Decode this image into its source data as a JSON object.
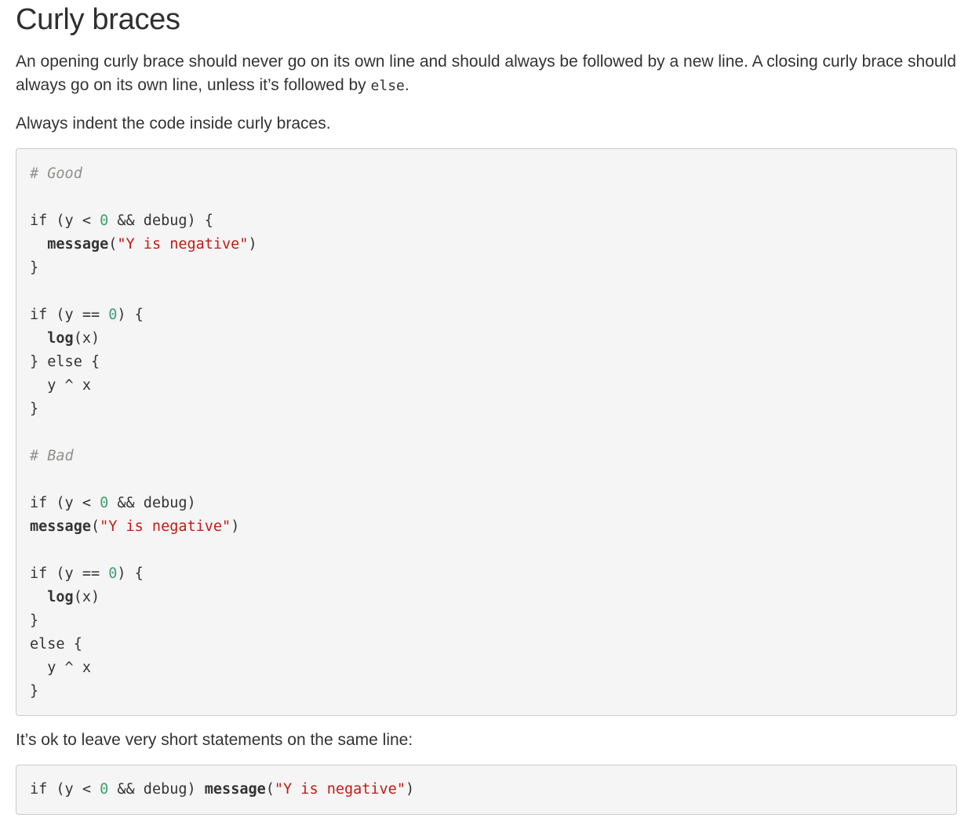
{
  "section": {
    "title": "Curly braces",
    "intro": {
      "before": "An opening curly brace should never go on its own line and should always be followed by a new line. A closing curly brace should always go on its own line, unless it’s followed by ",
      "code": "else",
      "after": "."
    },
    "indent_text": "Always indent the code inside curly braces.",
    "short_text": "It’s ok to leave very short statements on the same line:"
  },
  "code_block_1": {
    "lines": [
      [
        {
          "t": "# Good",
          "c": "comment"
        }
      ],
      [],
      [
        {
          "t": "if (y < "
        },
        {
          "t": "0",
          "c": "num"
        },
        {
          "t": " && debug) {"
        }
      ],
      [
        {
          "t": "  "
        },
        {
          "t": "message",
          "c": "fn"
        },
        {
          "t": "("
        },
        {
          "t": "\"Y is negative\"",
          "c": "str"
        },
        {
          "t": ")"
        }
      ],
      [
        {
          "t": "}"
        }
      ],
      [],
      [
        {
          "t": "if (y == "
        },
        {
          "t": "0",
          "c": "num"
        },
        {
          "t": ") {"
        }
      ],
      [
        {
          "t": "  "
        },
        {
          "t": "log",
          "c": "fn"
        },
        {
          "t": "(x)"
        }
      ],
      [
        {
          "t": "} else {"
        }
      ],
      [
        {
          "t": "  y ^ x"
        }
      ],
      [
        {
          "t": "}"
        }
      ],
      [],
      [
        {
          "t": "# Bad",
          "c": "comment"
        }
      ],
      [],
      [
        {
          "t": "if (y < "
        },
        {
          "t": "0",
          "c": "num"
        },
        {
          "t": " && debug)"
        }
      ],
      [
        {
          "t": "message",
          "c": "fn"
        },
        {
          "t": "("
        },
        {
          "t": "\"Y is negative\"",
          "c": "str"
        },
        {
          "t": ")"
        }
      ],
      [],
      [
        {
          "t": "if (y == "
        },
        {
          "t": "0",
          "c": "num"
        },
        {
          "t": ") {"
        }
      ],
      [
        {
          "t": "  "
        },
        {
          "t": "log",
          "c": "fn"
        },
        {
          "t": "(x)"
        }
      ],
      [
        {
          "t": "}"
        }
      ],
      [
        {
          "t": "else {"
        }
      ],
      [
        {
          "t": "  y ^ x"
        }
      ],
      [
        {
          "t": "}"
        }
      ]
    ]
  },
  "code_block_2": {
    "lines": [
      [
        {
          "t": "if (y < "
        },
        {
          "t": "0",
          "c": "num"
        },
        {
          "t": " && debug) "
        },
        {
          "t": "message",
          "c": "fn"
        },
        {
          "t": "("
        },
        {
          "t": "\"Y is negative\"",
          "c": "str"
        },
        {
          "t": ")"
        }
      ]
    ]
  },
  "colors": {
    "comment": "#8e908c",
    "number": "#40a070",
    "string": "#c41a16",
    "code_background": "#f5f5f5",
    "code_border": "#cccccc",
    "text": "#333333"
  }
}
